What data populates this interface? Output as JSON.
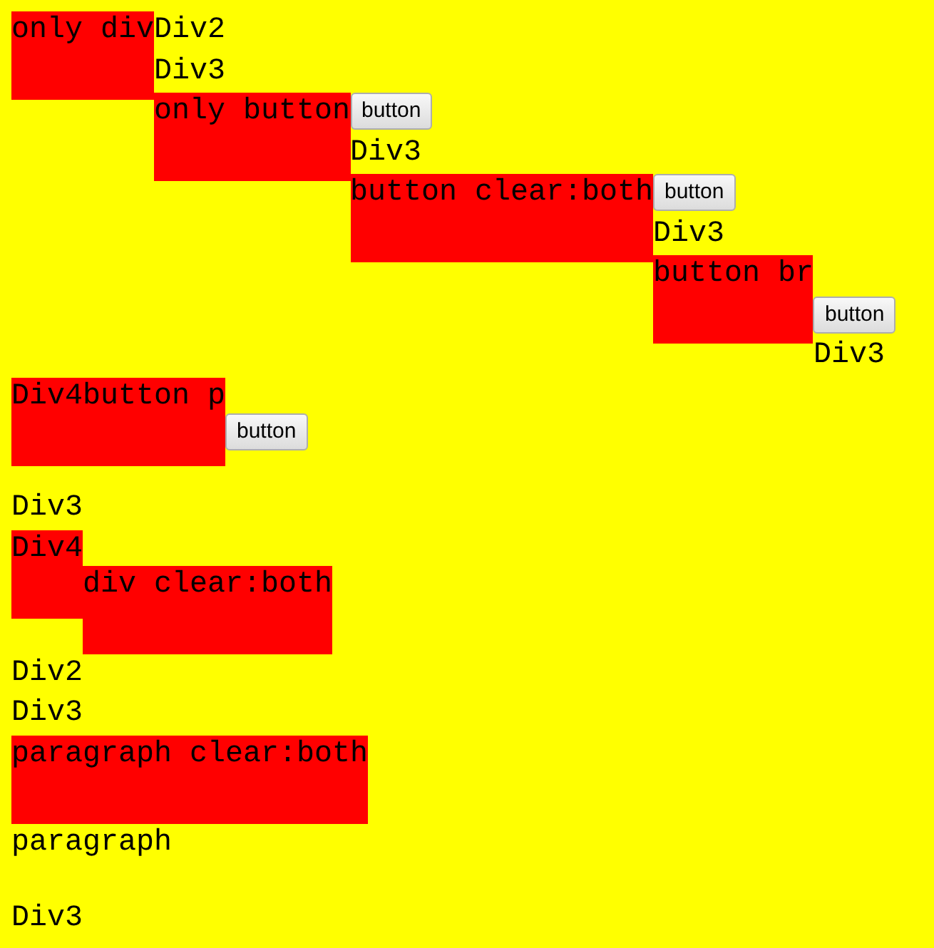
{
  "cases": [
    {
      "kind": "div",
      "boxes": [
        "only div"
      ],
      "lines": [
        "Div2",
        "Div3"
      ]
    },
    {
      "kind": "button",
      "boxes": [
        "only button"
      ],
      "button": "button",
      "lines": [
        "Div3"
      ]
    },
    {
      "kind": "button",
      "boxes": [
        "button clear:both"
      ],
      "button": "button",
      "lines": [
        "Div3"
      ]
    },
    {
      "kind": "button_br",
      "boxes": [
        "button br"
      ],
      "button": "button",
      "lines": [
        "Div3"
      ]
    },
    {
      "kind": "button_p",
      "boxes": [
        "Div4button p"
      ],
      "button": "button",
      "lines": [
        "Div3"
      ]
    },
    {
      "kind": "div_clear",
      "boxes": [
        "Div4",
        "div clear:both"
      ],
      "lines": [
        "Div2",
        "Div3"
      ]
    },
    {
      "kind": "p_clear",
      "boxes": [
        "paragraph clear:both"
      ],
      "paragraph": "paragraph",
      "lines": [
        "Div3"
      ]
    }
  ]
}
